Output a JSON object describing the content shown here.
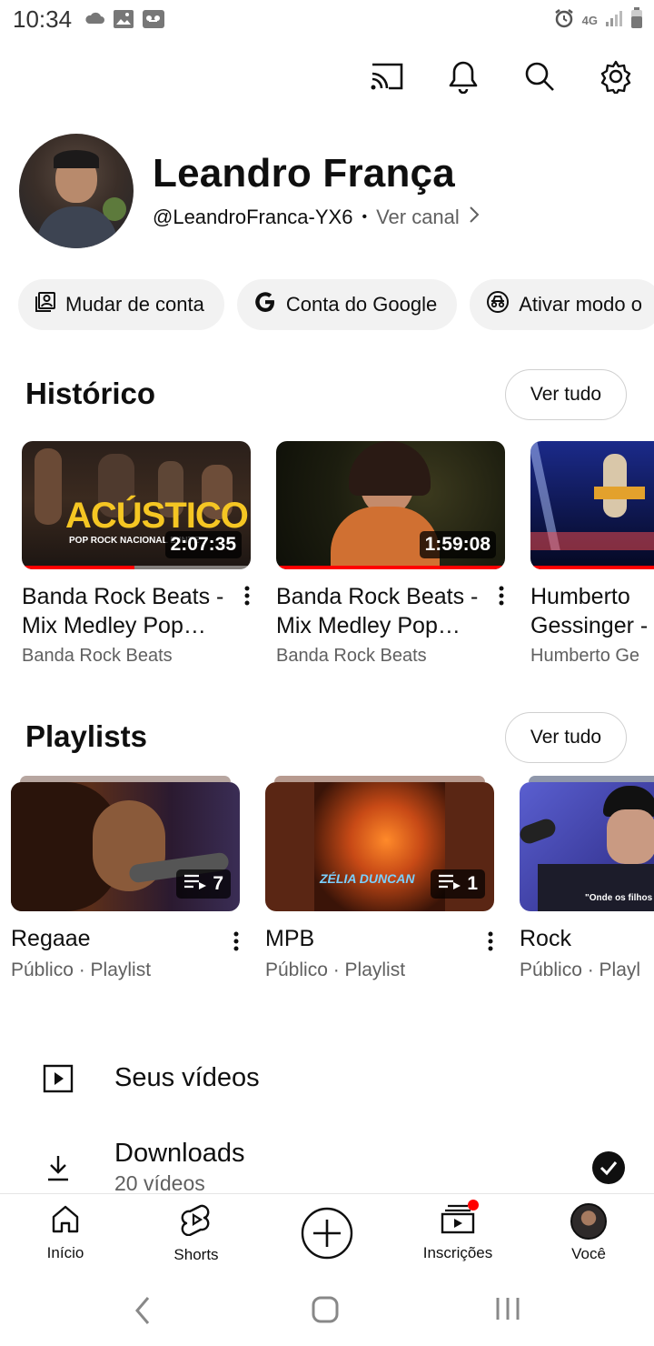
{
  "status_bar": {
    "time": "10:34",
    "network": "4G"
  },
  "top_actions": [
    "cast-icon",
    "bell-icon",
    "search-icon",
    "gear-icon"
  ],
  "profile": {
    "name": "Leandro França",
    "handle": "@LeandroFranca-YX6",
    "separator": "•",
    "view_channel": "Ver canal"
  },
  "chips": [
    {
      "label": "Mudar de conta",
      "icon": "switch-account-icon"
    },
    {
      "label": "Conta do Google",
      "icon": "google-g-icon"
    },
    {
      "label": "Ativar modo o",
      "icon": "incognito-icon"
    }
  ],
  "history": {
    "title": "Histórico",
    "see_all": "Ver tudo",
    "items": [
      {
        "title": "Banda Rock Beats - Mix Medley Pop…",
        "channel": "Banda Rock Beats",
        "duration": "2:07:35",
        "overlay_text": "ACÚSTICO",
        "overlay_sub": "POP ROCK NACIONAL E INTE",
        "watched": 0.49
      },
      {
        "title": "Banda Rock Beats - Mix Medley Pop…",
        "channel": "Banda Rock Beats",
        "duration": "1:59:08",
        "watched": 1.0
      },
      {
        "title": "Humberto Gessinger -",
        "channel": "Humberto Ge",
        "watched": 1.0
      }
    ]
  },
  "playlists": {
    "title": "Playlists",
    "see_all": "Ver tudo",
    "items": [
      {
        "title": "Regaae",
        "subtitle": "Público · Playlist",
        "count": "7"
      },
      {
        "title": "MPB",
        "subtitle": "Público · Playlist",
        "count": "1",
        "overlay_text": "ZÉLIA DUNCAN"
      },
      {
        "title": "Rock",
        "subtitle": "Público · Playl",
        "overlay_text": "\"Onde os filhos do a"
      }
    ]
  },
  "menu": [
    {
      "label": "Seus vídeos",
      "icon": "play-square-icon"
    },
    {
      "label": "Downloads",
      "sublabel": "20 vídeos",
      "icon": "download-icon",
      "status_icon": "check-circle-icon"
    }
  ],
  "bottom_nav": [
    {
      "label": "Início",
      "icon": "home-icon"
    },
    {
      "label": "Shorts",
      "icon": "shorts-icon"
    },
    {
      "label": "",
      "icon": "create-plus-icon"
    },
    {
      "label": "Inscrições",
      "icon": "subscriptions-icon"
    },
    {
      "label": "Você",
      "icon": "you-avatar-icon"
    }
  ],
  "colors": {
    "accent_red": "#ff0000",
    "text": "#0f0f0f",
    "muted": "#606060",
    "chip_bg": "#f2f2f2"
  }
}
